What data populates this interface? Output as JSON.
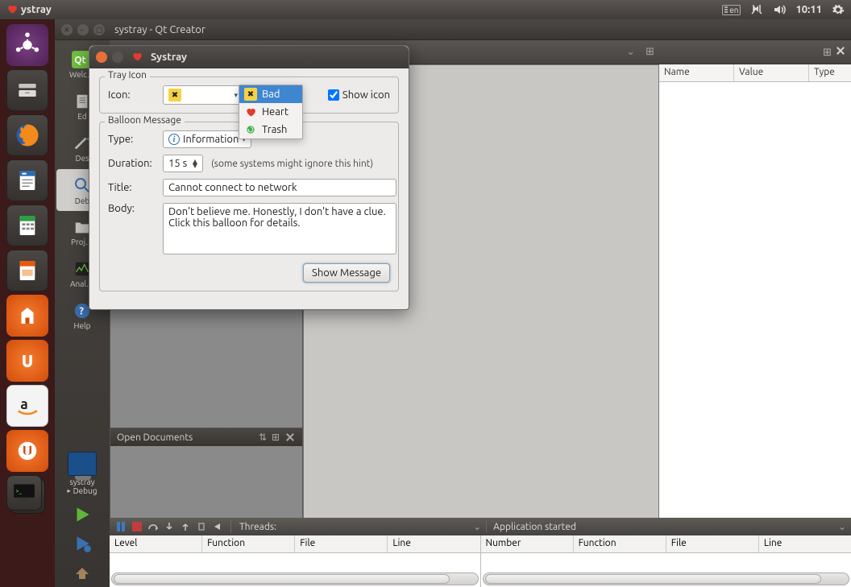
{
  "panel": {
    "app_title": "ystray",
    "lang": "en",
    "time": "10:11"
  },
  "qtc": {
    "title": "systray - Qt Creator",
    "sidebar": [
      "Welc…",
      "Ed",
      "Des",
      "Deb",
      "Proj…",
      "Anal…",
      "Help"
    ],
    "run": {
      "project": "systray",
      "config": "Debug"
    },
    "open_docs": "Open Documents",
    "threads_label": "Threads:",
    "app_status": "Application started",
    "rt_headers": {
      "name": "Name",
      "value": "Value",
      "type": "Type"
    },
    "dbg_left": [
      "Level",
      "Function",
      "File",
      "Line"
    ],
    "dbg_right": [
      "Number",
      "Function",
      "File",
      "Line"
    ]
  },
  "dialog": {
    "title": "Systray",
    "tray": {
      "legend": "Tray Icon",
      "icon_label": "Icon:",
      "selected": "Bad",
      "options": [
        "Bad",
        "Heart",
        "Trash"
      ],
      "show_icon_label": "Show icon",
      "show_icon_checked": true
    },
    "balloon": {
      "legend": "Balloon Message",
      "type_label": "Type:",
      "type_value": "Information",
      "duration_label": "Duration:",
      "duration_value": "15 s",
      "duration_hint": "(some systems might ignore this hint)",
      "title_label": "Title:",
      "title_value": "Cannot connect to network",
      "body_label": "Body:",
      "body_value": "Don't believe me. Honestly, I don't have a clue.\nClick this balloon for details.",
      "button": "Show Message"
    }
  }
}
